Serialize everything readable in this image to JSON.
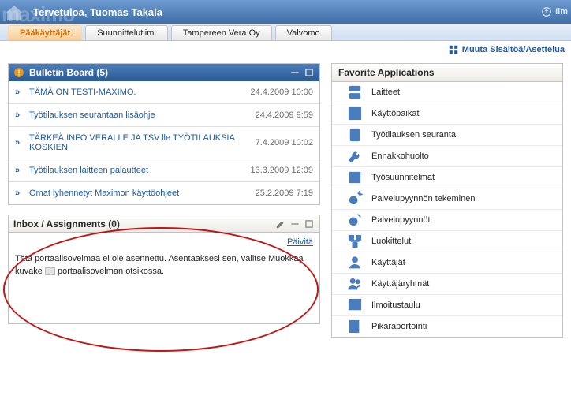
{
  "banner": {
    "welcome": "Tervetuloa, Tuomas Takala",
    "right_link": "Ilm"
  },
  "tabs": [
    {
      "label": "Pääkäyttäjät",
      "active": true
    },
    {
      "label": "Suunnittelutiimi"
    },
    {
      "label": "Tampereen Vera Oy"
    },
    {
      "label": "Valvomo"
    }
  ],
  "edit_layout": "Muuta Sisältöä/Asettelua",
  "bulletin": {
    "title": "Bulletin Board (5)",
    "rows": [
      {
        "text": "TÄMÄ ON TESTI-MAXIMO.",
        "date": "24.4.2009 10:00"
      },
      {
        "text": "Työtilauksen seurantaan lisäohje",
        "date": "24.4.2009 9:59"
      },
      {
        "text": "TÄRKEÄ INFO VERALLE JA TSV:lle TYÖTILAUKSIA KOSKIEN",
        "date": "7.4.2009 10:02"
      },
      {
        "text": "Työtilauksen laitteen palautteet",
        "date": "13.3.2009 12:09"
      },
      {
        "text": "Omat lyhennetyt Maximon käyttöohjeet",
        "date": "25.2.2009 7:19"
      }
    ]
  },
  "inbox": {
    "title": "Inbox / Assignments (0)",
    "refresh": "Päivitä",
    "text_a": "Tätä portaalisovelmaa ei ole asennettu. Asentaaksesi sen, valitse Muokkaa kuvake ",
    "text_b": " portaalisovelman otsikossa."
  },
  "favorites": {
    "title": "Favorite Applications",
    "items": [
      {
        "label": "Laitteet",
        "icon": "server"
      },
      {
        "label": "Käyttöpaikat",
        "icon": "location"
      },
      {
        "label": "Työtilauksen seuranta",
        "icon": "clipboard"
      },
      {
        "label": "Ennakkohuolto",
        "icon": "wrench"
      },
      {
        "label": "Työsuunnitelmat",
        "icon": "plan"
      },
      {
        "label": "Palvelupyynnön tekeminen",
        "icon": "service-new"
      },
      {
        "label": "Palvelupyynnöt",
        "icon": "service"
      },
      {
        "label": "Luokittelut",
        "icon": "classify"
      },
      {
        "label": "Käyttäjät",
        "icon": "user"
      },
      {
        "label": "Käyttäjäryhmät",
        "icon": "users"
      },
      {
        "label": "Ilmoitustaulu",
        "icon": "board"
      },
      {
        "label": "Pikaraportointi",
        "icon": "report"
      }
    ]
  }
}
